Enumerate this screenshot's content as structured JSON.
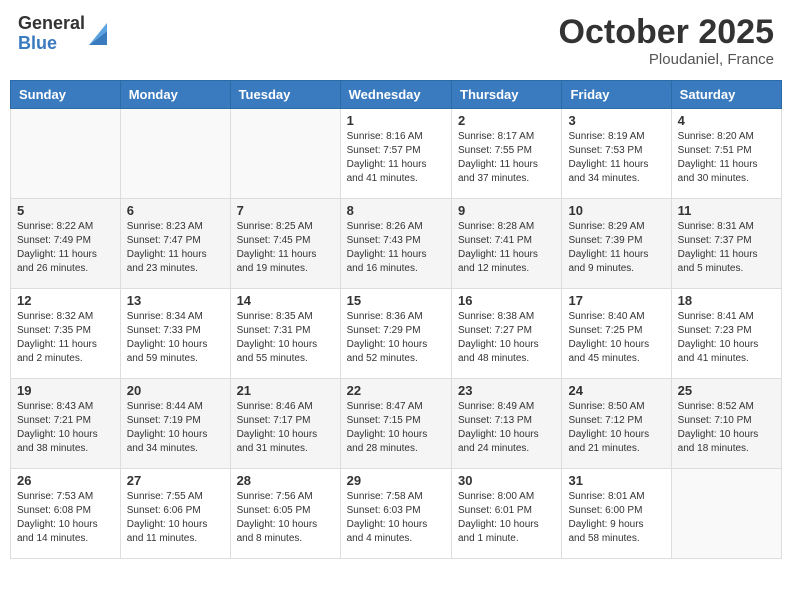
{
  "header": {
    "logo_general": "General",
    "logo_blue": "Blue",
    "month_title": "October 2025",
    "location": "Ploudaniel, France"
  },
  "days_of_week": [
    "Sunday",
    "Monday",
    "Tuesday",
    "Wednesday",
    "Thursday",
    "Friday",
    "Saturday"
  ],
  "weeks": [
    [
      {
        "day": "",
        "info": ""
      },
      {
        "day": "",
        "info": ""
      },
      {
        "day": "",
        "info": ""
      },
      {
        "day": "1",
        "info": "Sunrise: 8:16 AM\nSunset: 7:57 PM\nDaylight: 11 hours\nand 41 minutes."
      },
      {
        "day": "2",
        "info": "Sunrise: 8:17 AM\nSunset: 7:55 PM\nDaylight: 11 hours\nand 37 minutes."
      },
      {
        "day": "3",
        "info": "Sunrise: 8:19 AM\nSunset: 7:53 PM\nDaylight: 11 hours\nand 34 minutes."
      },
      {
        "day": "4",
        "info": "Sunrise: 8:20 AM\nSunset: 7:51 PM\nDaylight: 11 hours\nand 30 minutes."
      }
    ],
    [
      {
        "day": "5",
        "info": "Sunrise: 8:22 AM\nSunset: 7:49 PM\nDaylight: 11 hours\nand 26 minutes."
      },
      {
        "day": "6",
        "info": "Sunrise: 8:23 AM\nSunset: 7:47 PM\nDaylight: 11 hours\nand 23 minutes."
      },
      {
        "day": "7",
        "info": "Sunrise: 8:25 AM\nSunset: 7:45 PM\nDaylight: 11 hours\nand 19 minutes."
      },
      {
        "day": "8",
        "info": "Sunrise: 8:26 AM\nSunset: 7:43 PM\nDaylight: 11 hours\nand 16 minutes."
      },
      {
        "day": "9",
        "info": "Sunrise: 8:28 AM\nSunset: 7:41 PM\nDaylight: 11 hours\nand 12 minutes."
      },
      {
        "day": "10",
        "info": "Sunrise: 8:29 AM\nSunset: 7:39 PM\nDaylight: 11 hours\nand 9 minutes."
      },
      {
        "day": "11",
        "info": "Sunrise: 8:31 AM\nSunset: 7:37 PM\nDaylight: 11 hours\nand 5 minutes."
      }
    ],
    [
      {
        "day": "12",
        "info": "Sunrise: 8:32 AM\nSunset: 7:35 PM\nDaylight: 11 hours\nand 2 minutes."
      },
      {
        "day": "13",
        "info": "Sunrise: 8:34 AM\nSunset: 7:33 PM\nDaylight: 10 hours\nand 59 minutes."
      },
      {
        "day": "14",
        "info": "Sunrise: 8:35 AM\nSunset: 7:31 PM\nDaylight: 10 hours\nand 55 minutes."
      },
      {
        "day": "15",
        "info": "Sunrise: 8:36 AM\nSunset: 7:29 PM\nDaylight: 10 hours\nand 52 minutes."
      },
      {
        "day": "16",
        "info": "Sunrise: 8:38 AM\nSunset: 7:27 PM\nDaylight: 10 hours\nand 48 minutes."
      },
      {
        "day": "17",
        "info": "Sunrise: 8:40 AM\nSunset: 7:25 PM\nDaylight: 10 hours\nand 45 minutes."
      },
      {
        "day": "18",
        "info": "Sunrise: 8:41 AM\nSunset: 7:23 PM\nDaylight: 10 hours\nand 41 minutes."
      }
    ],
    [
      {
        "day": "19",
        "info": "Sunrise: 8:43 AM\nSunset: 7:21 PM\nDaylight: 10 hours\nand 38 minutes."
      },
      {
        "day": "20",
        "info": "Sunrise: 8:44 AM\nSunset: 7:19 PM\nDaylight: 10 hours\nand 34 minutes."
      },
      {
        "day": "21",
        "info": "Sunrise: 8:46 AM\nSunset: 7:17 PM\nDaylight: 10 hours\nand 31 minutes."
      },
      {
        "day": "22",
        "info": "Sunrise: 8:47 AM\nSunset: 7:15 PM\nDaylight: 10 hours\nand 28 minutes."
      },
      {
        "day": "23",
        "info": "Sunrise: 8:49 AM\nSunset: 7:13 PM\nDaylight: 10 hours\nand 24 minutes."
      },
      {
        "day": "24",
        "info": "Sunrise: 8:50 AM\nSunset: 7:12 PM\nDaylight: 10 hours\nand 21 minutes."
      },
      {
        "day": "25",
        "info": "Sunrise: 8:52 AM\nSunset: 7:10 PM\nDaylight: 10 hours\nand 18 minutes."
      }
    ],
    [
      {
        "day": "26",
        "info": "Sunrise: 7:53 AM\nSunset: 6:08 PM\nDaylight: 10 hours\nand 14 minutes."
      },
      {
        "day": "27",
        "info": "Sunrise: 7:55 AM\nSunset: 6:06 PM\nDaylight: 10 hours\nand 11 minutes."
      },
      {
        "day": "28",
        "info": "Sunrise: 7:56 AM\nSunset: 6:05 PM\nDaylight: 10 hours\nand 8 minutes."
      },
      {
        "day": "29",
        "info": "Sunrise: 7:58 AM\nSunset: 6:03 PM\nDaylight: 10 hours\nand 4 minutes."
      },
      {
        "day": "30",
        "info": "Sunrise: 8:00 AM\nSunset: 6:01 PM\nDaylight: 10 hours\nand 1 minute."
      },
      {
        "day": "31",
        "info": "Sunrise: 8:01 AM\nSunset: 6:00 PM\nDaylight: 9 hours\nand 58 minutes."
      },
      {
        "day": "",
        "info": ""
      }
    ]
  ]
}
